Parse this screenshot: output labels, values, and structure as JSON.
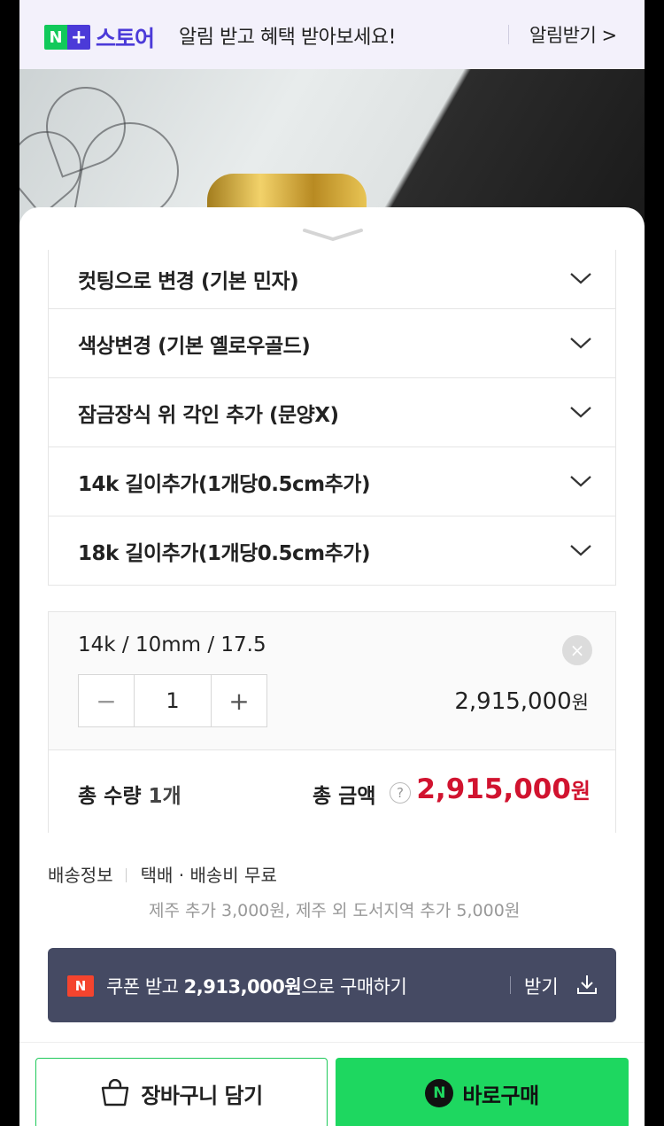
{
  "banner": {
    "logo_n": "N",
    "logo_plus": "+",
    "logo_store": "스토어",
    "message": "알림 받고 혜택 받아보세요!",
    "link": "알림받기 >"
  },
  "options": [
    {
      "label": "컷팅으로 변경 (기본 민자)"
    },
    {
      "label": "색상변경 (기본 옐로우골드)"
    },
    {
      "label": "잠금장식 위 각인 추가 (문양X)"
    },
    {
      "label": "14k 길이추가(1개당0.5cm추가)"
    },
    {
      "label": "18k 길이추가(1개당0.5cm추가)"
    }
  ],
  "selected_item": {
    "title": "14k / 10mm / 17.5",
    "remove_icon": "×",
    "minus": "−",
    "quantity": "1",
    "plus": "+",
    "price": "2,915,000",
    "price_unit": "원"
  },
  "total": {
    "qty_label": "총 수량 ",
    "qty_value": "1개",
    "amount_label": "총 금액",
    "help_icon": "?",
    "amount": "2,915,000",
    "amount_unit": "원"
  },
  "shipping": {
    "label": "배송정보",
    "value": "택배 · 배송비 무료",
    "extra": "제주 추가 3,000원, 제주 외 도서지역 추가 5,000원"
  },
  "coupon": {
    "badge": "N",
    "text_pre": "쿠폰 받고 ",
    "text_amount": "2,913,000원",
    "text_post": "으로 구매하기",
    "receive": "받기"
  },
  "actions": {
    "cart": "장바구니 담기",
    "buy_icon": "N",
    "buy": "바로구매"
  },
  "colors": {
    "naver_green": "#1ed760",
    "price_red": "#d1132f",
    "coupon_bg": "#454a63",
    "store_purple": "#4b3ad8"
  }
}
